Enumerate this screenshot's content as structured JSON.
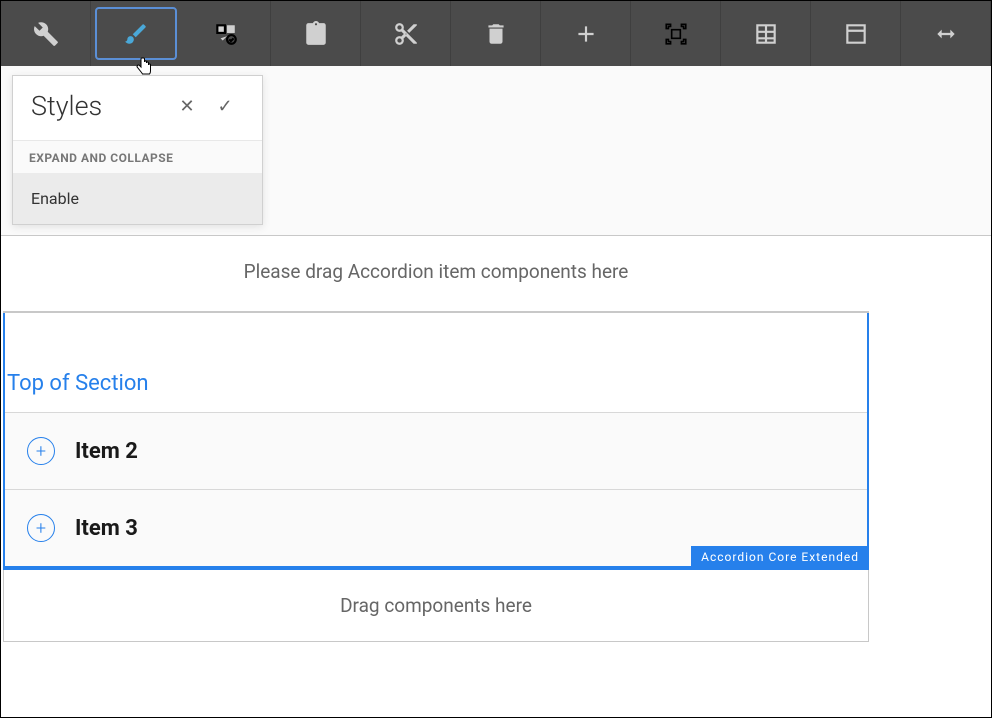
{
  "toolbar": {
    "buttons": [
      {
        "name": "wrench-icon"
      },
      {
        "name": "brush-icon",
        "active": true
      },
      {
        "name": "component-icon"
      },
      {
        "name": "paste-icon"
      },
      {
        "name": "cut-icon"
      },
      {
        "name": "delete-icon"
      },
      {
        "name": "add-icon"
      },
      {
        "name": "group-icon"
      },
      {
        "name": "table-icon"
      },
      {
        "name": "panel-icon"
      },
      {
        "name": "expand-icon"
      }
    ]
  },
  "styles_popup": {
    "title": "Styles",
    "section_header": "EXPAND AND COLLAPSE",
    "option": "Enable"
  },
  "drop_accordion_text": "Please drag Accordion item components here",
  "section": {
    "title": "Top of Section",
    "items": [
      {
        "label": "Item 2"
      },
      {
        "label": "Item 3"
      }
    ],
    "badge": "Accordion Core Extended"
  },
  "drop_generic_text": "Drag components here"
}
